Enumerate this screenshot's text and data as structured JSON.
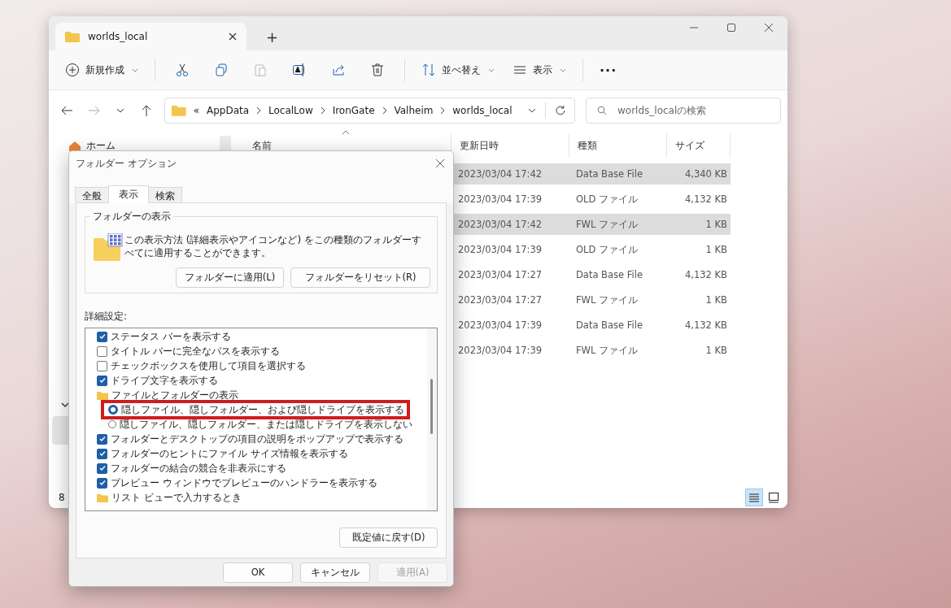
{
  "explorer": {
    "tab_title": "worlds_local",
    "new_tab": "+",
    "toolbar": {
      "new": "新規作成",
      "sort": "並べ替え",
      "view": "表示",
      "more": "···"
    },
    "breadcrumb": {
      "overflow": "«",
      "segments": [
        "AppData",
        "LocalLow",
        "IronGate",
        "Valheim",
        "worlds_local"
      ]
    },
    "search": {
      "placeholder": "worlds_localの検索"
    },
    "sidebar": {
      "items": [
        {
          "label": "ホーム",
          "selected": false
        },
        {
          "selected": true
        }
      ]
    },
    "status_bar": "8",
    "table": {
      "columns": [
        "名前",
        "更新日時",
        "種類",
        "サイズ"
      ],
      "rows": [
        {
          "modified": "2023/03/04 17:42",
          "type": "Data Base File",
          "size": "4,340 KB",
          "selected": true
        },
        {
          "modified": "2023/03/04 17:39",
          "type": "OLD ファイル",
          "size": "4,132 KB",
          "selected": false
        },
        {
          "modified": "2023/03/04 17:42",
          "type": "FWL ファイル",
          "size": "1 KB",
          "selected": true
        },
        {
          "modified": "2023/03/04 17:39",
          "type": "OLD ファイル",
          "size": "1 KB",
          "selected": false
        },
        {
          "modified": "2023/03/04 17:27",
          "type": "Data Base File",
          "size": "4,132 KB",
          "selected": false
        },
        {
          "modified": "2023/03/04 17:27",
          "type": "FWL ファイル",
          "size": "1 KB",
          "selected": false
        },
        {
          "modified": "2023/03/04 17:39",
          "type": "Data Base File",
          "size": "4,132 KB",
          "selected": false
        },
        {
          "modified": "2023/03/04 17:39",
          "type": "FWL ファイル",
          "size": "1 KB",
          "selected": false
        }
      ]
    },
    "view_buttons": [
      {
        "kind": "details",
        "selected": true
      },
      {
        "kind": "tiles",
        "selected": false
      }
    ]
  },
  "dialog": {
    "title": "フォルダー オプション",
    "tabs": [
      {
        "label": "全般",
        "selected": false
      },
      {
        "label": "表示",
        "selected": true
      },
      {
        "label": "検索",
        "selected": false
      }
    ],
    "folder_views": {
      "legend": "フォルダーの表示",
      "description": "この表示方法 (詳細表示やアイコンなど) をこの種類のフォルダーすべてに適用することができます。",
      "buttons": [
        "フォルダーに適用(L)",
        "フォルダーをリセット(R)"
      ]
    },
    "advanced_label": "詳細設定:",
    "settings": [
      {
        "kind": "checkbox",
        "label": "ステータス バーを表示する",
        "checked": true,
        "highlighted": false
      },
      {
        "kind": "checkbox",
        "label": "タイトル バーに完全なパスを表示する",
        "checked": false,
        "highlighted": false
      },
      {
        "kind": "checkbox",
        "label": "チェックボックスを使用して項目を選択する",
        "checked": false,
        "highlighted": false
      },
      {
        "kind": "checkbox",
        "label": "ドライブ文字を表示する",
        "checked": true,
        "highlighted": false
      },
      {
        "kind": "folder",
        "label": "ファイルとフォルダーの表示",
        "highlighted": false
      },
      {
        "kind": "radio",
        "label": "隠しファイル、隠しフォルダー、および隠しドライブを表示する",
        "selected": true,
        "highlighted": true
      },
      {
        "kind": "radio",
        "label": "隠しファイル、隠しフォルダー、または隠しドライブを表示しない",
        "selected": false,
        "highlighted": false
      },
      {
        "kind": "checkbox",
        "label": "フォルダーとデスクトップの項目の説明をポップアップで表示する",
        "checked": true,
        "highlighted": false
      },
      {
        "kind": "checkbox",
        "label": "フォルダーのヒントにファイル サイズ情報を表示する",
        "checked": true,
        "highlighted": false
      },
      {
        "kind": "checkbox",
        "label": "フォルダーの結合の競合を非表示にする",
        "checked": true,
        "highlighted": false
      },
      {
        "kind": "checkbox",
        "label": "プレビュー ウィンドウでプレビューのハンドラーを表示する",
        "checked": true,
        "highlighted": false
      },
      {
        "kind": "folder",
        "label": "リスト ビューで入力するとき",
        "highlighted": false
      }
    ],
    "restore_button": "既定値に戻す(D)",
    "buttons": [
      {
        "label": "OK",
        "disabled": false
      },
      {
        "label": "キャンセル",
        "disabled": false
      },
      {
        "label": "適用(A)",
        "disabled": true
      }
    ]
  }
}
